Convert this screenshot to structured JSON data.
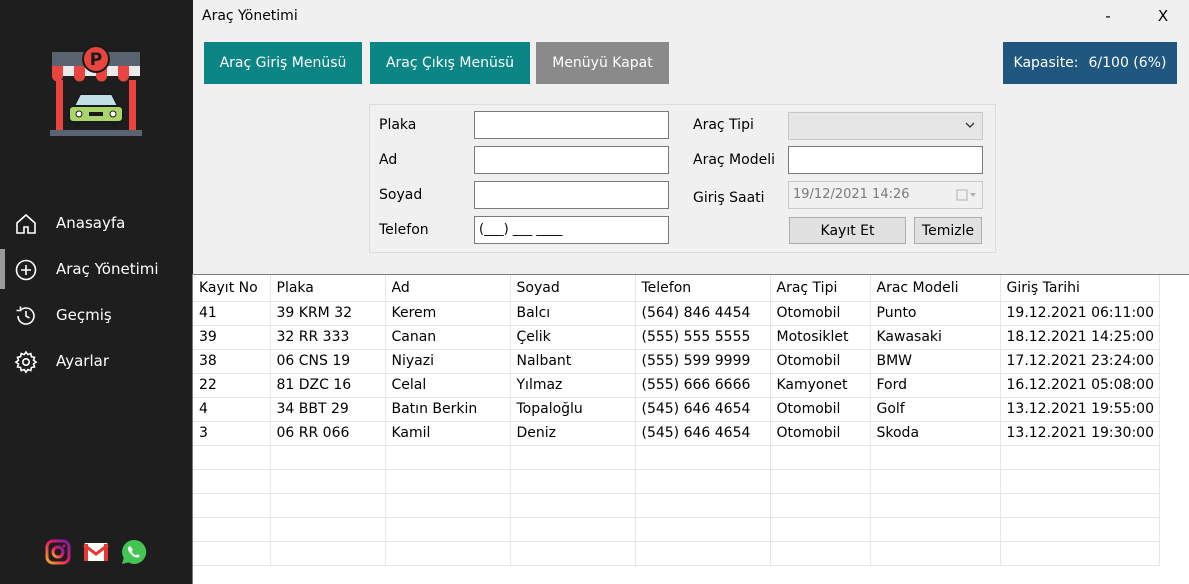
{
  "window": {
    "title": "Araç Yönetimi",
    "minimize_label": "-",
    "close_label": "X"
  },
  "sidebar": {
    "items": [
      {
        "label": "Anasayfa",
        "icon": "home-icon"
      },
      {
        "label": "Araç Yönetimi",
        "icon": "plus-circle-icon"
      },
      {
        "label": "Geçmiş",
        "icon": "history-icon"
      },
      {
        "label": "Ayarlar",
        "icon": "gear-icon"
      }
    ],
    "active_index": 1,
    "social": [
      "instagram-icon",
      "gmail-icon",
      "whatsapp-icon"
    ]
  },
  "toolbar": {
    "giris_label": "Araç Giriş Menüsü",
    "cikis_label": "Araç Çıkış Menüsü",
    "kapat_label": "Menüyü Kapat",
    "kapasite_label": "Kapasite:",
    "kapasite_value": "6/100 (6%)"
  },
  "form": {
    "plaka_label": "Plaka",
    "plaka_value": "",
    "ad_label": "Ad",
    "ad_value": "",
    "soyad_label": "Soyad",
    "soyad_value": "",
    "telefon_label": "Telefon",
    "telefon_value": "(___) ___ ____",
    "arac_tipi_label": "Araç Tipi",
    "arac_tipi_value": "",
    "arac_modeli_label": "Araç Modeli",
    "arac_modeli_value": "",
    "giris_saati_label": "Giriş Saati",
    "giris_saati_value": "19/12/2021 14:26",
    "kayit_label": "Kayıt Et",
    "temizle_label": "Temizle"
  },
  "table": {
    "headers": [
      "Kayıt No",
      "Plaka",
      "Ad",
      "Soyad",
      "Telefon",
      "Araç Tipi",
      "Arac Modeli",
      "Giriş Tarihi"
    ],
    "rows": [
      [
        "41",
        "39 KRM 32",
        "Kerem",
        "Balcı",
        "(564) 846 4454",
        "Otomobil",
        "Punto",
        "19.12.2021 06:11:00"
      ],
      [
        "39",
        "32 RR 333",
        "Canan",
        "Çelik",
        "(555) 555 5555",
        "Motosiklet",
        "Kawasaki",
        "18.12.2021 14:25:00"
      ],
      [
        "38",
        "06 CNS 19",
        "Niyazi",
        "Nalbant",
        "(555) 599 9999",
        "Otomobil",
        "BMW",
        "17.12.2021 23:24:00"
      ],
      [
        "22",
        "81 DZC 16",
        "Celal",
        "Yılmaz",
        "(555) 666 6666",
        "Kamyonet",
        "Ford",
        "16.12.2021 05:08:00"
      ],
      [
        "4",
        "34 BBT 29",
        "Batın Berkin",
        "Topaloğlu",
        "(545) 646 4654",
        "Otomobil",
        "Golf",
        "13.12.2021 19:55:00"
      ],
      [
        "3",
        "06 RR 066",
        "Kamil",
        "Deniz",
        "(545) 646 4654",
        "Otomobil",
        "Skoda",
        "13.12.2021 19:30:00"
      ]
    ],
    "empty_rows": 5
  },
  "colors": {
    "sidebar_bg": "#1e1e1e",
    "teal": "#0c8585",
    "gray_button": "#8a8a8a",
    "kapasite_bg": "#1f5780"
  }
}
